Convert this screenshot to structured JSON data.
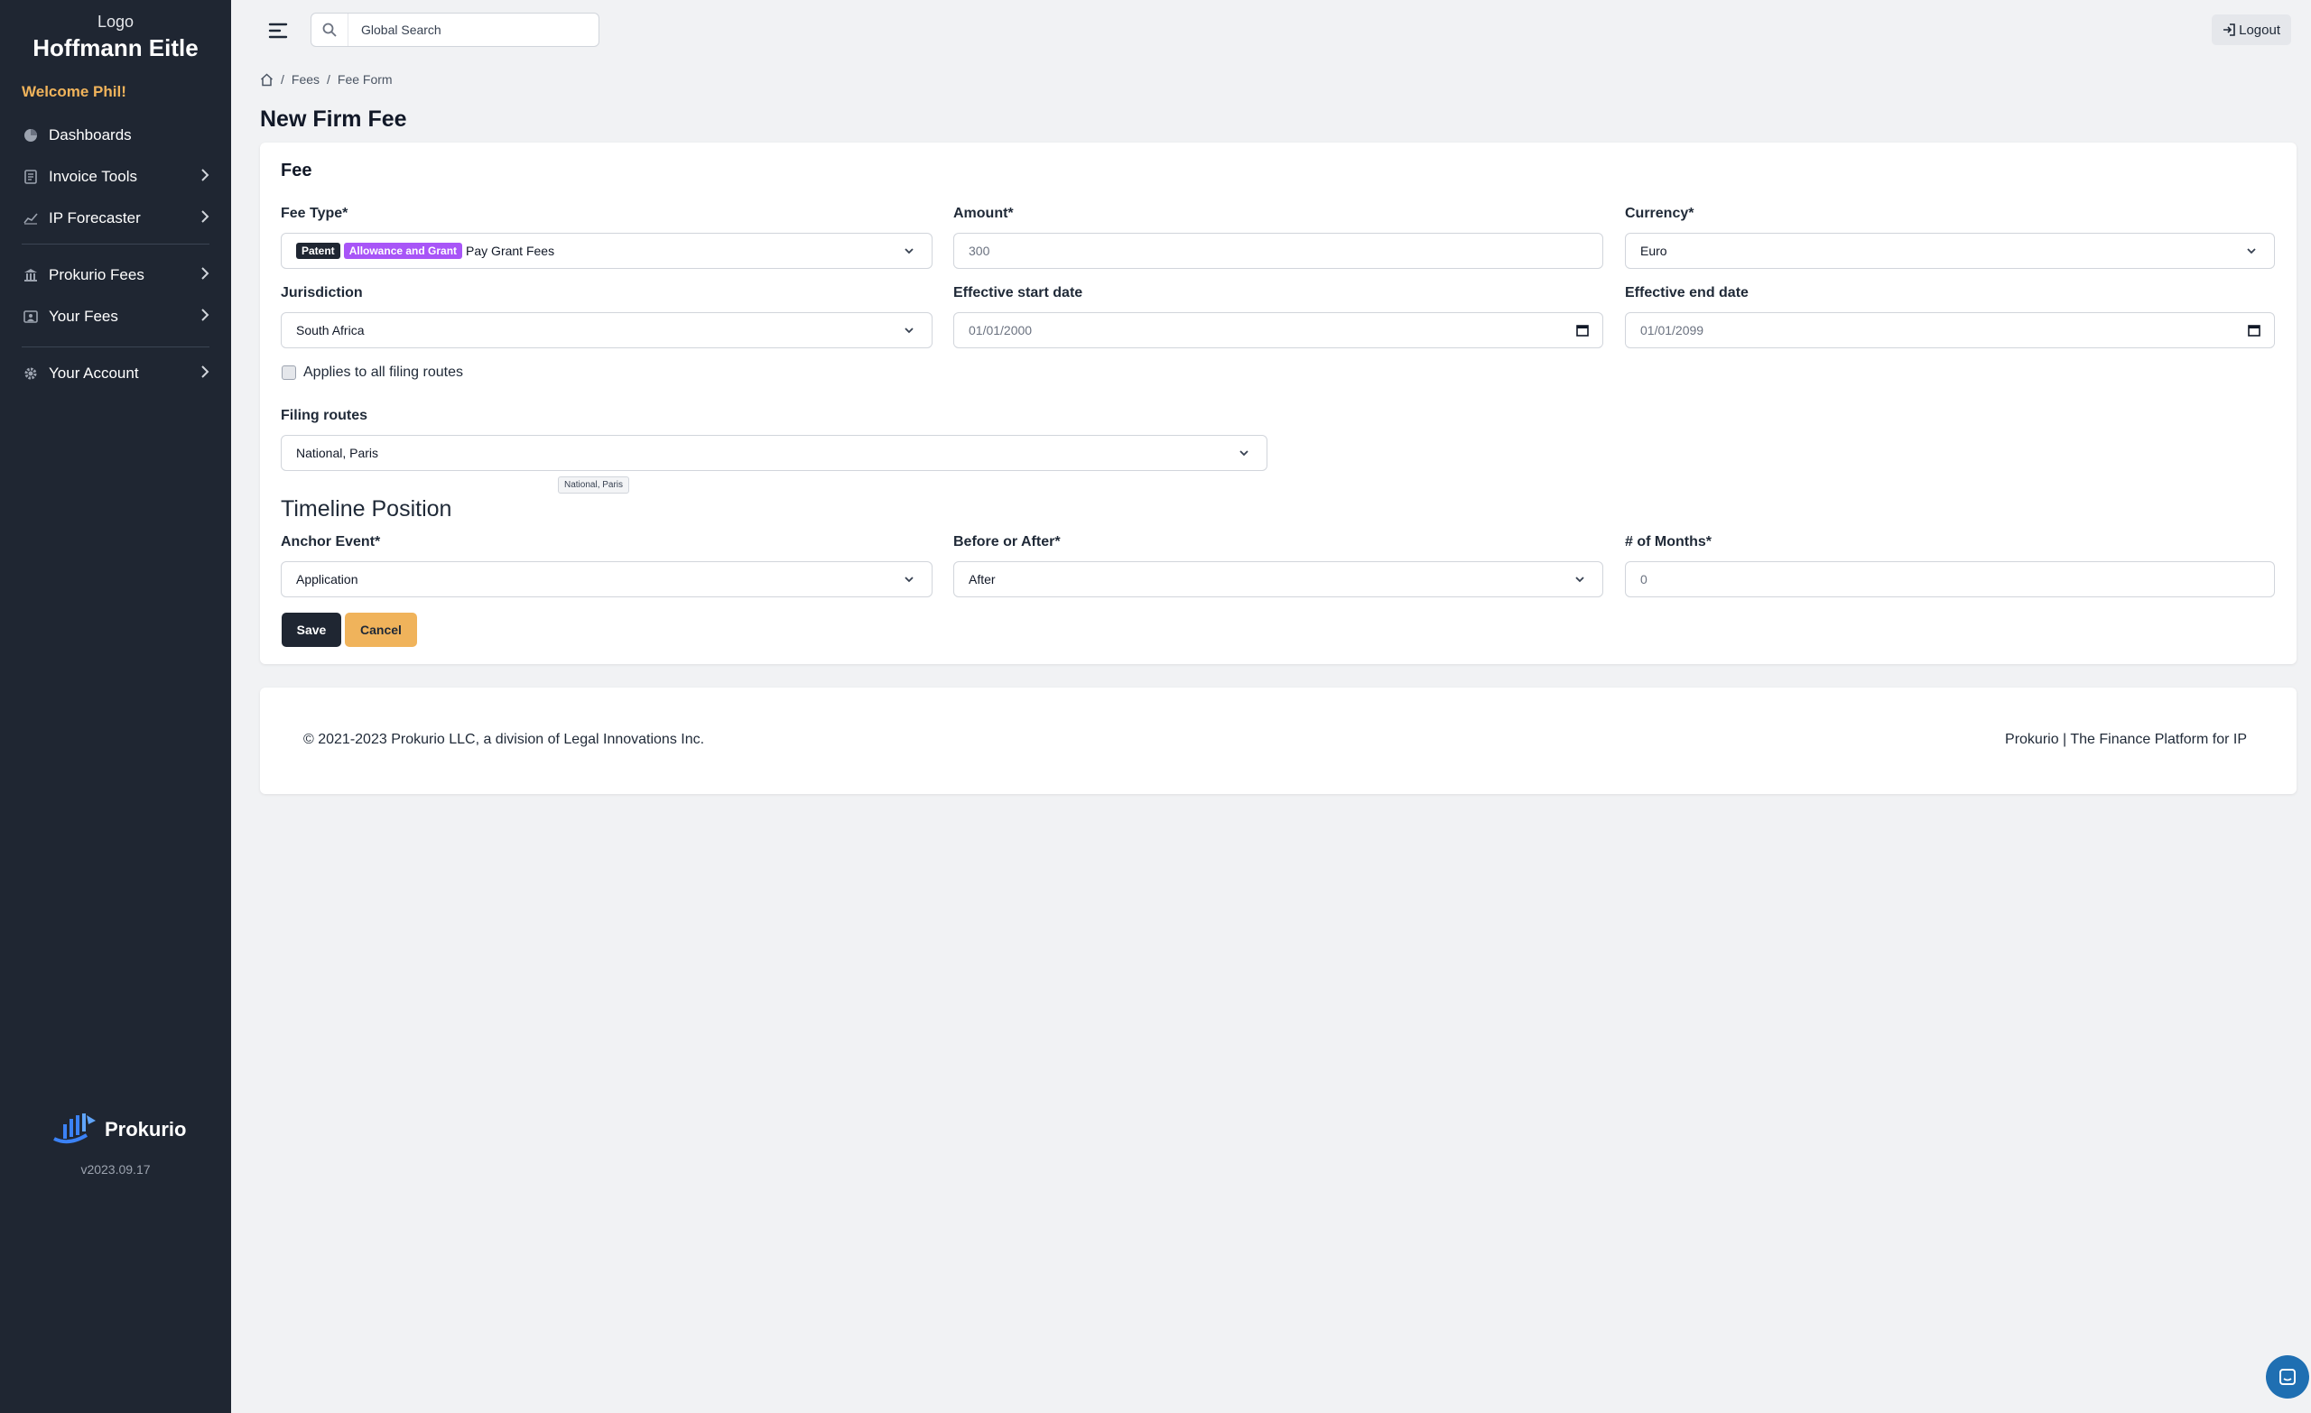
{
  "sidebar": {
    "logo_alt": "Logo",
    "firm_name": "Hoffmann Eitle",
    "welcome": "Welcome Phil!",
    "items": [
      {
        "label": "Dashboards",
        "icon": "pie-chart-icon"
      },
      {
        "label": "Invoice Tools",
        "icon": "invoice-icon"
      },
      {
        "label": "IP Forecaster",
        "icon": "line-chart-icon"
      },
      {
        "label": "Prokurio Fees",
        "icon": "bank-icon"
      },
      {
        "label": "Your Fees",
        "icon": "id-card-icon"
      },
      {
        "label": "Your Account",
        "icon": "gear-icon"
      }
    ],
    "product_name": "Prokurio",
    "version": "v2023.09.17"
  },
  "header": {
    "search_placeholder": "Global Search",
    "logout_label": "Logout"
  },
  "breadcrumb": {
    "items": [
      "Fees",
      "Fee Form"
    ]
  },
  "page_title": "New Firm Fee",
  "form": {
    "section_title": "Fee",
    "fee_type": {
      "label": "Fee Type*",
      "badge1": "Patent",
      "badge2": "Allowance and Grant",
      "value": "Pay Grant Fees"
    },
    "amount": {
      "label": "Amount*",
      "value": "300"
    },
    "currency": {
      "label": "Currency*",
      "value": "Euro"
    },
    "jurisdiction": {
      "label": "Jurisdiction",
      "value": "South Africa"
    },
    "start_date": {
      "label": "Effective start date",
      "value": "01/01/2000"
    },
    "end_date": {
      "label": "Effective end date",
      "value": "01/01/2099"
    },
    "applies_all": {
      "label": "Applies to all filing routes",
      "checked": false
    },
    "filing_routes": {
      "label": "Filing routes",
      "value": "National, Paris",
      "tooltip": "National, Paris"
    },
    "timeline_title": "Timeline Position",
    "anchor_event": {
      "label": "Anchor Event*",
      "value": "Application"
    },
    "before_after": {
      "label": "Before or After*",
      "value": "After"
    },
    "months": {
      "label": "# of Months*",
      "value": "0"
    },
    "save_label": "Save",
    "cancel_label": "Cancel"
  },
  "footer": {
    "copyright": "© 2021-2023 Prokurio LLC, a division of Legal Innovations Inc.",
    "tagline": "Prokurio | The Finance Platform for IP"
  },
  "colors": {
    "sidebar_bg": "#1f2632",
    "accent": "#f0b35b",
    "badge_purple": "#a855f7"
  }
}
